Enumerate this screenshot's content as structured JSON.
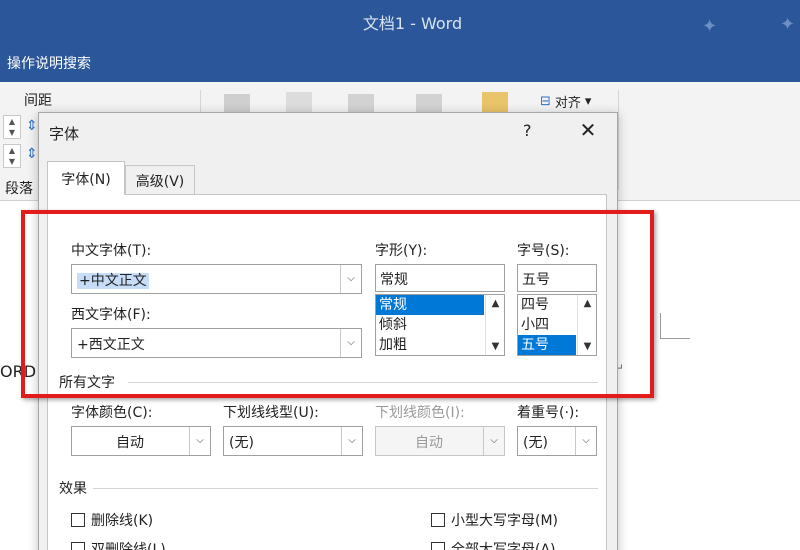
{
  "app": {
    "window_title": "文档1  -  Word",
    "search_label": "操作说明搜索"
  },
  "ribbon": {
    "spacing_label": "间距",
    "paragraph_label": "段落",
    "align_label": "对齐",
    "align_dropdown": "▾"
  },
  "document": {
    "visible_text": "ORD 里",
    "paragraph_mark": "↵"
  },
  "dialog": {
    "title": "字体",
    "help": "?",
    "close": "✕",
    "tabs": [
      {
        "label": "字体(N)",
        "active": true
      },
      {
        "label": "高级(V)",
        "active": false
      }
    ],
    "chinese_font": {
      "label": "中文字体(T):",
      "value": "+中文正文"
    },
    "western_font": {
      "label": "西文字体(F):",
      "value": "+西文正文"
    },
    "style": {
      "label": "字形(Y):",
      "value": "常规",
      "options": [
        "常规",
        "倾斜",
        "加粗"
      ],
      "selected": "常规"
    },
    "size": {
      "label": "字号(S):",
      "value": "五号",
      "options": [
        "四号",
        "小四",
        "五号"
      ],
      "selected": "五号"
    },
    "all_text": {
      "section": "所有文字",
      "font_color": {
        "label": "字体颜色(C):",
        "value": "自动"
      },
      "underline_type": {
        "label": "下划线线型(U):",
        "value": "(无)"
      },
      "underline_color": {
        "label": "下划线颜色(I):",
        "value": "自动",
        "disabled": true
      },
      "emphasis": {
        "label": "着重号(·):",
        "value": "(无)"
      }
    },
    "effects": {
      "section": "效果",
      "checkboxes": [
        {
          "label": "删除线(K)",
          "checked": false
        },
        {
          "label": "双删除线(L)",
          "checked": false
        },
        {
          "label": "小型大写字母(M)",
          "checked": false
        },
        {
          "label": "全部大写字母(A)",
          "checked": false
        }
      ]
    }
  },
  "icons": {
    "dropdown": "⌵",
    "scroll_up": "▲",
    "scroll_down": "▼"
  },
  "colors": {
    "word_blue": "#2b579a",
    "selection_blue": "#0078d7",
    "highlight_red": "#e21b1b"
  }
}
